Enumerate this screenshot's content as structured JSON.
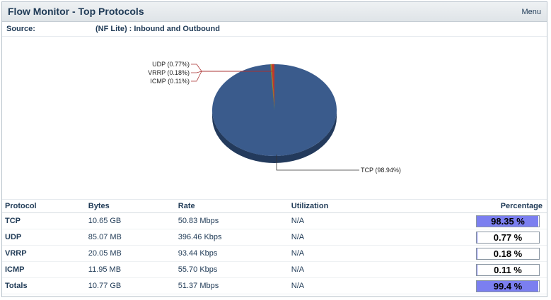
{
  "header": {
    "title": "Flow Monitor - Top Protocols",
    "menu_label": "Menu"
  },
  "source": {
    "label": "Source:",
    "value": "(NF Lite) : Inbound and Outbound"
  },
  "chart_data": {
    "type": "pie",
    "slices": [
      {
        "label": "TCP (98.94%)",
        "value": 98.94,
        "color": "#3a5b8c"
      },
      {
        "label": "UDP (0.77%)",
        "value": 0.77,
        "color": "#c0392b"
      },
      {
        "label": "VRRP (0.18%)",
        "value": 0.18,
        "color": "#b5852a"
      },
      {
        "label": "ICMP (0.11%)",
        "value": 0.11,
        "color": "#6d8c3a"
      }
    ]
  },
  "table": {
    "headers": {
      "protocol": "Protocol",
      "bytes": "Bytes",
      "rate": "Rate",
      "utilization": "Utilization",
      "percentage": "Percentage"
    },
    "rows": [
      {
        "protocol": "TCP",
        "bytes": "10.65 GB",
        "rate": "50.83 Mbps",
        "utilization": "N/A",
        "percentage_text": "98.35 %",
        "percentage": 98.35
      },
      {
        "protocol": "UDP",
        "bytes": "85.07 MB",
        "rate": "396.46 Kbps",
        "utilization": "N/A",
        "percentage_text": "0.77 %",
        "percentage": 0.77
      },
      {
        "protocol": "VRRP",
        "bytes": "20.05 MB",
        "rate": "93.44 Kbps",
        "utilization": "N/A",
        "percentage_text": "0.18 %",
        "percentage": 0.18
      },
      {
        "protocol": "ICMP",
        "bytes": "11.95 MB",
        "rate": "55.70 Kbps",
        "utilization": "N/A",
        "percentage_text": "0.11 %",
        "percentage": 0.11
      },
      {
        "protocol": "Totals",
        "bytes": "10.77 GB",
        "rate": "51.37 Mbps",
        "utilization": "N/A",
        "percentage_text": "99.4 %",
        "percentage": 99.4
      }
    ]
  }
}
